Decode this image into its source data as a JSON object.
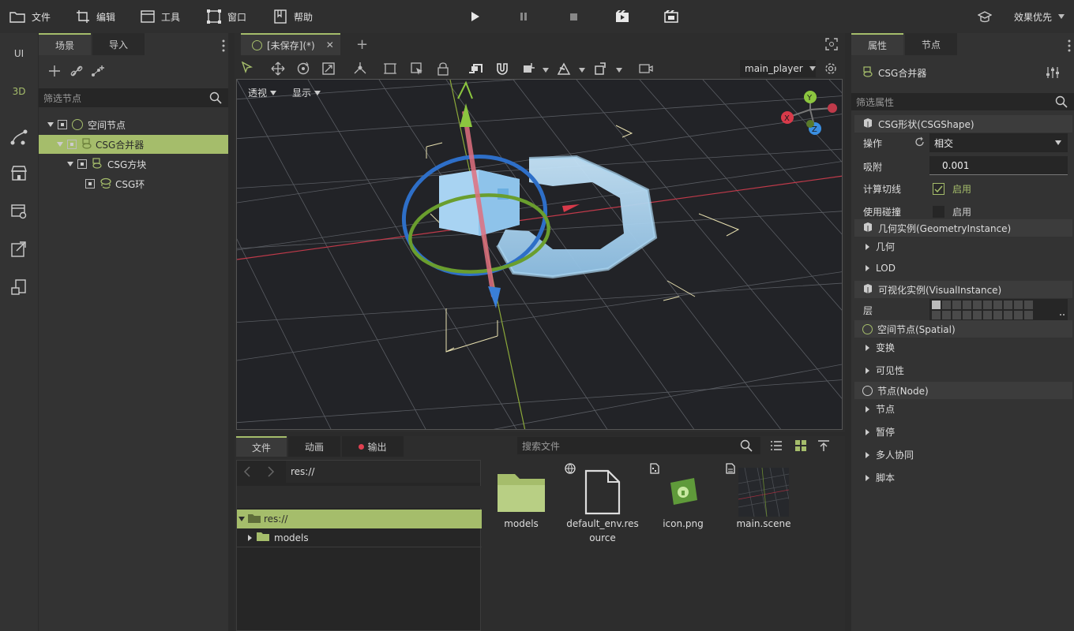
{
  "menu": {
    "file": "文件",
    "edit": "编辑",
    "tools": "工具",
    "window": "窗口",
    "help": "帮助",
    "render_mode": "效果优先"
  },
  "leftbar": {
    "ui": "UI",
    "threed": "3D"
  },
  "scene_panel": {
    "tab_scene": "场景",
    "tab_import": "导入",
    "filter_placeholder": "筛选节点",
    "nodes": [
      {
        "label": "空间节点"
      },
      {
        "label": "CSG合并器"
      },
      {
        "label": "CSG方块"
      },
      {
        "label": "CSG环"
      }
    ]
  },
  "editor": {
    "tab_title": "[未保存](*)",
    "perspective": "透视",
    "display": "显示",
    "camera_select": "main_player",
    "gizmo": {
      "y": "Y",
      "x": "X",
      "z": "Z"
    }
  },
  "bottom": {
    "tab_files": "文件",
    "tab_animation": "动画",
    "tab_output": "输出",
    "search_placeholder": "搜索文件",
    "path": "res://",
    "tree": [
      {
        "label": "res://"
      },
      {
        "label": "models"
      }
    ],
    "files": [
      {
        "name": "models"
      },
      {
        "name": "default_env.resource"
      },
      {
        "name": "icon.png"
      },
      {
        "name": "main.scene"
      }
    ]
  },
  "inspector": {
    "tab_properties": "属性",
    "tab_node": "节点",
    "node_name": "CSG合并器",
    "filter_placeholder": "筛选属性",
    "sections": {
      "csgshape": "CSG形状(CSGShape)",
      "geometry": "几何实例(GeometryInstance)",
      "visual": "可视化实例(VisualInstance)",
      "spatial": "空间节点(Spatial)",
      "node": "节点(Node)"
    },
    "props": {
      "operation_label": "操作",
      "operation_value": "相交",
      "snap_label": "吸附",
      "snap_value": "0.001",
      "calc_tangents_label": "计算切线",
      "calc_tangents_value": "启用",
      "use_collision_label": "使用碰撞",
      "use_collision_value": "启用",
      "geometry": "几何",
      "lod": "LOD",
      "layers_label": "层",
      "transform": "变换",
      "visibility": "可见性",
      "node_sub": "节点",
      "pause": "暂停",
      "multiplayer": "多人协同",
      "script": "脚本"
    }
  },
  "colors": {
    "accent": "#a5bd6b",
    "background": "#2b2b2b",
    "panel": "#333333",
    "axis_x": "#e04050",
    "axis_y": "#8ec63f",
    "axis_z": "#3a8ee0"
  }
}
